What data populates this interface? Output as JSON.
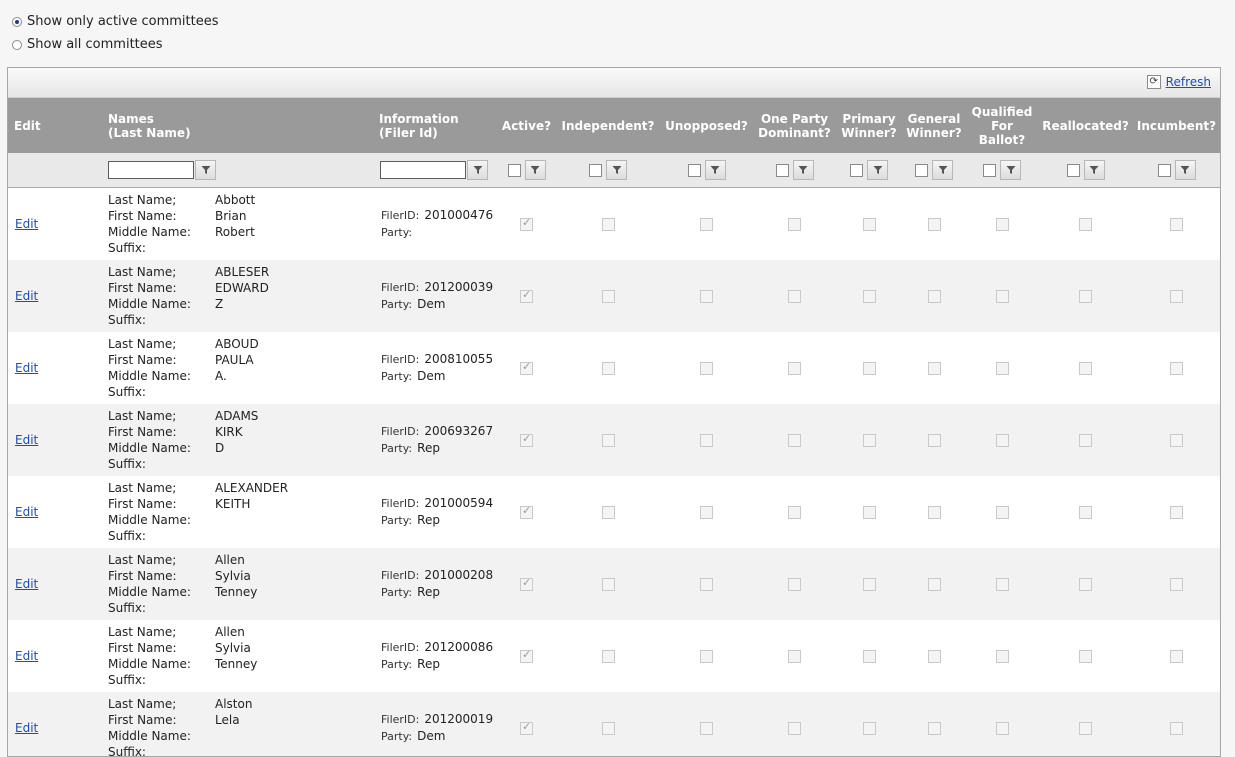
{
  "filter_options": {
    "active_only": "Show only active committees",
    "all": "Show all committees",
    "selected": "active_only"
  },
  "toolbar": {
    "refresh_label": "Refresh"
  },
  "columns": {
    "edit": "Edit",
    "names": [
      "Names",
      "(Last Name)"
    ],
    "information": [
      "Information",
      "(Filer Id)"
    ],
    "active": "Active?",
    "independent": "Independent?",
    "unopposed": "Unopposed?",
    "one_party_dominant": [
      "One Party",
      "Dominant?"
    ],
    "primary_winner": [
      "Primary",
      "Winner?"
    ],
    "general_winner": [
      "General",
      "Winner?"
    ],
    "qualified_for_ballot": [
      "Qualified",
      "For",
      "Ballot?"
    ],
    "reallocated": "Reallocated?",
    "incumbent": "Incumbent?"
  },
  "labels": {
    "edit_link": "Edit",
    "last_name": "Last Name;",
    "first_name": "First Name:",
    "middle_name": "Middle Name:",
    "suffix": "Suffix:",
    "filer_id": "FilerID:",
    "party": "Party:"
  },
  "rows": [
    {
      "last": "Abbott",
      "first": "Brian",
      "middle": "Robert",
      "suffix": "",
      "filer_id": "201000476",
      "party": "",
      "active": true
    },
    {
      "last": "ABLESER",
      "first": "EDWARD",
      "middle": "Z",
      "suffix": "",
      "filer_id": "201200039",
      "party": "Dem",
      "active": true
    },
    {
      "last": "ABOUD",
      "first": "PAULA",
      "middle": "A.",
      "suffix": "",
      "filer_id": "200810055",
      "party": "Dem",
      "active": true
    },
    {
      "last": "ADAMS",
      "first": "KIRK",
      "middle": "D",
      "suffix": "",
      "filer_id": "200693267",
      "party": "Rep",
      "active": true
    },
    {
      "last": "ALEXANDER",
      "first": "KEITH",
      "middle": "",
      "suffix": "",
      "filer_id": "201000594",
      "party": "Rep",
      "active": true
    },
    {
      "last": "Allen",
      "first": "Sylvia",
      "middle": "Tenney",
      "suffix": "",
      "filer_id": "201000208",
      "party": "Rep",
      "active": true
    },
    {
      "last": "Allen",
      "first": "Sylvia",
      "middle": "Tenney",
      "suffix": "",
      "filer_id": "201200086",
      "party": "Rep",
      "active": true
    },
    {
      "last": "Alston",
      "first": "Lela",
      "middle": "",
      "suffix": "",
      "filer_id": "201200019",
      "party": "Dem",
      "active": true
    }
  ],
  "icons": {
    "filter": "filter-funnel-icon",
    "refresh": "refresh-icon"
  }
}
